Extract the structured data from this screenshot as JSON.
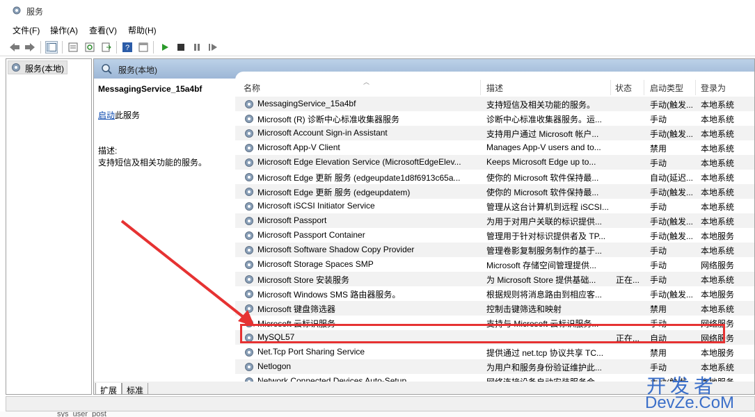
{
  "window": {
    "title": "服务"
  },
  "menu": [
    "文件(F)",
    "操作(A)",
    "查看(V)",
    "帮助(H)"
  ],
  "tree": {
    "item": "服务(本地)"
  },
  "main_header": "服务(本地)",
  "detail": {
    "service_name": "MessagingService_15a4bf",
    "start_link": "启动",
    "start_suffix": "此服务",
    "desc_label": "描述:",
    "desc_text": "支持短信及相关功能的服务。"
  },
  "columns": [
    "名称",
    "描述",
    "状态",
    "启动类型",
    "登录为"
  ],
  "rows": [
    {
      "name": "MessagingService_15a4bf",
      "desc": "支持短信及相关功能的服务。",
      "state": "",
      "start": "手动(触发...",
      "logon": "本地系统"
    },
    {
      "name": "Microsoft (R) 诊断中心标准收集器服务",
      "desc": "诊断中心标准收集器服务。运...",
      "state": "",
      "start": "手动",
      "logon": "本地系统"
    },
    {
      "name": "Microsoft Account Sign-in Assistant",
      "desc": "支持用户通过 Microsoft 帐户...",
      "state": "",
      "start": "手动(触发...",
      "logon": "本地系统"
    },
    {
      "name": "Microsoft App-V Client",
      "desc": "Manages App-V users and to...",
      "state": "",
      "start": "禁用",
      "logon": "本地系统"
    },
    {
      "name": "Microsoft Edge Elevation Service (MicrosoftEdgeElev...",
      "desc": "Keeps Microsoft Edge up to...",
      "state": "",
      "start": "手动",
      "logon": "本地系统"
    },
    {
      "name": "Microsoft Edge 更新 服务 (edgeupdate1d8f6913c65a...",
      "desc": "使你的 Microsoft 软件保持最...",
      "state": "",
      "start": "自动(延迟...",
      "logon": "本地系统"
    },
    {
      "name": "Microsoft Edge 更新 服务 (edgeupdatem)",
      "desc": "使你的 Microsoft 软件保持最...",
      "state": "",
      "start": "手动(触发...",
      "logon": "本地系统"
    },
    {
      "name": "Microsoft iSCSI Initiator Service",
      "desc": "管理从这台计算机到远程 iSCSI...",
      "state": "",
      "start": "手动",
      "logon": "本地系统"
    },
    {
      "name": "Microsoft Passport",
      "desc": "为用于对用户关联的标识提供...",
      "state": "",
      "start": "手动(触发...",
      "logon": "本地系统"
    },
    {
      "name": "Microsoft Passport Container",
      "desc": "管理用于针对标识提供者及 TP...",
      "state": "",
      "start": "手动(触发...",
      "logon": "本地服务"
    },
    {
      "name": "Microsoft Software Shadow Copy Provider",
      "desc": "管理卷影复制服务制作的基于...",
      "state": "",
      "start": "手动",
      "logon": "本地系统"
    },
    {
      "name": "Microsoft Storage Spaces SMP",
      "desc": "Microsoft 存储空间管理提供...",
      "state": "",
      "start": "手动",
      "logon": "网络服务"
    },
    {
      "name": "Microsoft Store 安装服务",
      "desc": "为 Microsoft Store 提供基础...",
      "state": "正在...",
      "start": "手动",
      "logon": "本地系统"
    },
    {
      "name": "Microsoft Windows SMS 路由器服务。",
      "desc": "根据规则将消息路由到相应客...",
      "state": "",
      "start": "手动(触发...",
      "logon": "本地服务"
    },
    {
      "name": "Microsoft 键盘筛选器",
      "desc": "控制击键筛选和映射",
      "state": "",
      "start": "禁用",
      "logon": "本地系统"
    },
    {
      "name": "Microsoft 云标识服务",
      "desc": "支持与 Microsoft 云标识服务...",
      "state": "",
      "start": "手动",
      "logon": "网络服务"
    },
    {
      "name": "MySQL57",
      "desc": "",
      "state": "正在...",
      "start": "自动",
      "logon": "网络服务"
    },
    {
      "name": "Net.Tcp Port Sharing Service",
      "desc": "提供通过 net.tcp 协议共享 TC...",
      "state": "",
      "start": "禁用",
      "logon": "本地服务"
    },
    {
      "name": "Netlogon",
      "desc": "为用户和服务身份验证维护此...",
      "state": "",
      "start": "手动",
      "logon": "本地系统"
    },
    {
      "name": "Network Connected Devices Auto-Setup",
      "desc": "网络连接设备自动安装服务会...",
      "state": "",
      "start": "手动(触发...",
      "logon": "本地服务"
    }
  ],
  "tabs": [
    "扩展",
    "标准"
  ],
  "bottom_text": "sys_user_post",
  "watermark": {
    "top": "开发者",
    "bottom": "DevZe.CoM"
  },
  "colors": {
    "highlight": "#e63232",
    "header_blue": "#9db7d6",
    "watermark": "#3b6fc9"
  }
}
